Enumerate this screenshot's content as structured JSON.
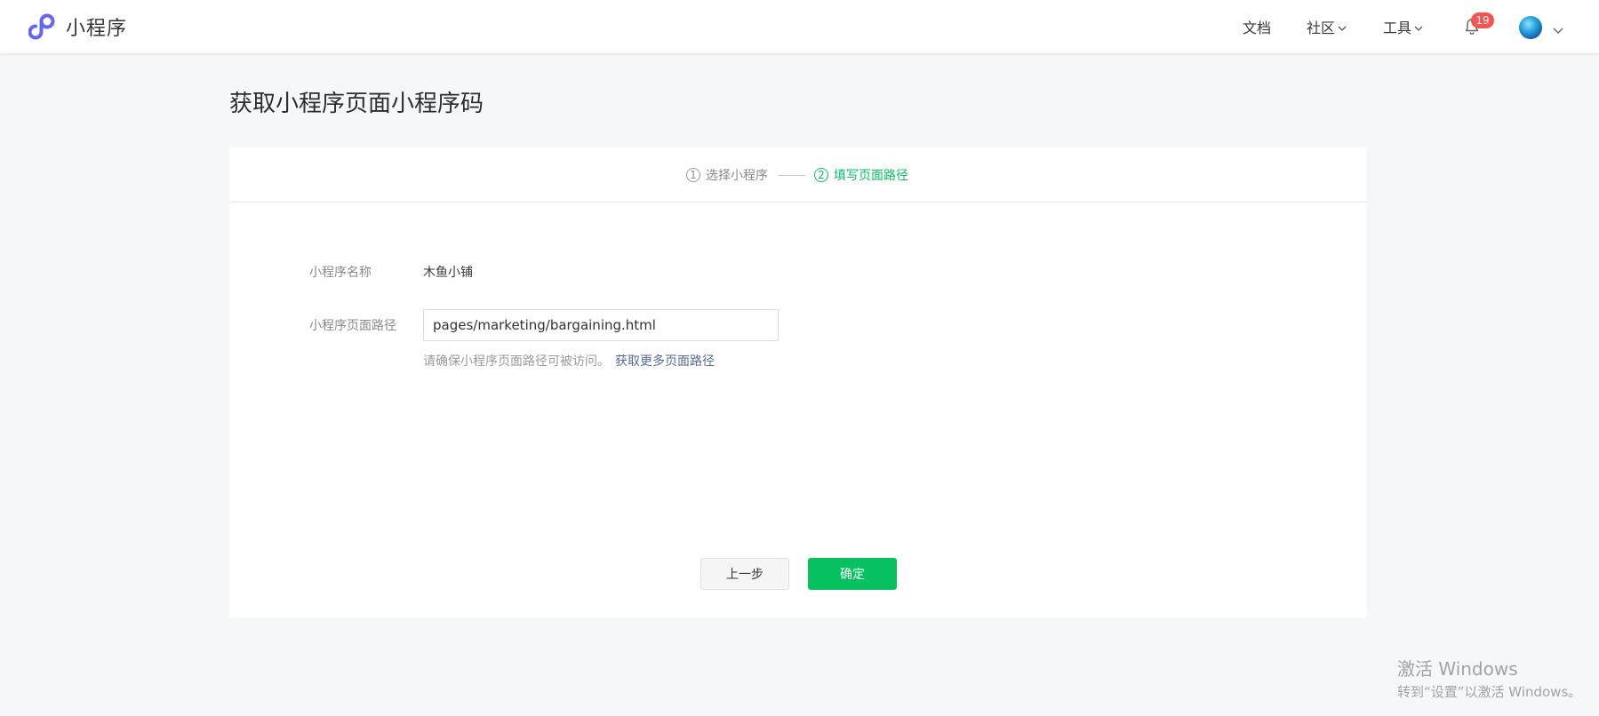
{
  "header": {
    "brand_name": "小程序",
    "nav": {
      "docs": "文档",
      "community": "社区",
      "tools": "工具"
    },
    "notifications": {
      "badge_count": "19",
      "icon": "bell-icon"
    },
    "avatar_icon": "user-avatar"
  },
  "page": {
    "title": "获取小程序页面小程序码"
  },
  "steps": [
    {
      "num": "1",
      "label": "选择小程序",
      "state": "done"
    },
    {
      "num": "2",
      "label": "填写页面路径",
      "state": "active"
    }
  ],
  "form": {
    "name_label": "小程序名称",
    "name_value": "木鱼小铺",
    "path_label": "小程序页面路径",
    "path_value": "pages/marketing/bargaining.html",
    "hint_text": "请确保小程序页面路径可被访问。",
    "hint_link": "获取更多页面路径"
  },
  "buttons": {
    "prev": "上一步",
    "confirm": "确定"
  },
  "watermark": {
    "title": "激活 Windows",
    "subtitle": "转到“设置”以激活 Windows。"
  },
  "colors": {
    "accent_green": "#07c160",
    "link_blue": "#576b95",
    "badge_red": "#fa5151",
    "page_background": "#f6f7f9"
  }
}
